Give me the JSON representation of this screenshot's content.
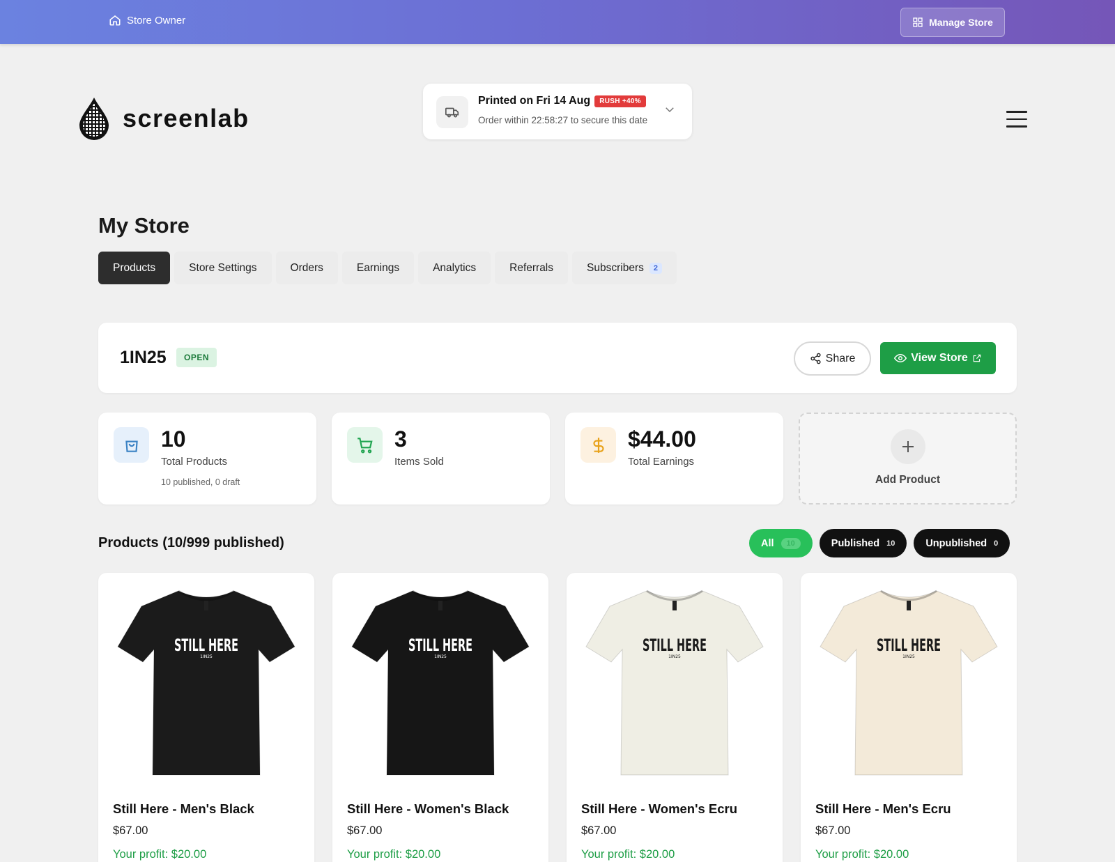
{
  "topbar": {
    "owner_label": "Store Owner",
    "manage_label": "Manage Store"
  },
  "brand": {
    "name": "screenlab"
  },
  "print_notice": {
    "title": "Printed on Fri 14 Aug",
    "badge": "RUSH +40%",
    "subtitle": "Order within 22:58:27 to secure this date"
  },
  "page": {
    "title": "My Store"
  },
  "tabs": [
    {
      "label": "Products"
    },
    {
      "label": "Store Settings"
    },
    {
      "label": "Orders"
    },
    {
      "label": "Earnings"
    },
    {
      "label": "Analytics"
    },
    {
      "label": "Referrals"
    },
    {
      "label": "Subscribers",
      "badge": "2"
    }
  ],
  "store": {
    "name": "1IN25",
    "status": "OPEN",
    "share_label": "Share",
    "view_label": "View Store"
  },
  "stats": [
    {
      "value": "10",
      "label": "Total Products",
      "sub": "10 published, 0 draft"
    },
    {
      "value": "3",
      "label": "Items Sold"
    },
    {
      "value": "$44.00",
      "label": "Total Earnings"
    }
  ],
  "add_product": {
    "label": "Add Product"
  },
  "products_section": {
    "title": "Products (10/999 published)",
    "filters": [
      {
        "label": "All",
        "count": "10"
      },
      {
        "label": "Published",
        "count": "10"
      },
      {
        "label": "Unpublished",
        "count": "0"
      }
    ]
  },
  "products": [
    {
      "name": "Still Here - Men's Black",
      "price": "$67.00",
      "profit": "Your profit: $20.00",
      "shirt_color": "#1b1b1b",
      "print_color": "#ffffff",
      "print_text": "STILL HERE",
      "print_sub": "1IN25"
    },
    {
      "name": "Still Here - Women's Black",
      "price": "$67.00",
      "profit": "Your profit: $20.00",
      "shirt_color": "#161616",
      "print_color": "#ffffff",
      "print_text": "STILL HERE",
      "print_sub": "1IN25"
    },
    {
      "name": "Still Here - Women's Ecru",
      "price": "$67.00",
      "profit": "Your profit: $20.00",
      "shirt_color": "#efeee4",
      "print_color": "#1a1a1a",
      "print_text": "STILL HERE",
      "print_sub": "1IN25"
    },
    {
      "name": "Still Here - Men's Ecru",
      "price": "$67.00",
      "profit": "Your profit: $20.00",
      "shirt_color": "#f3ead9",
      "print_color": "#1a1a1a",
      "print_text": "STILL HERE",
      "print_sub": "1IN25"
    }
  ],
  "colors": {
    "accent_green": "#1e9e46",
    "rush_red": "#e23b3b",
    "gradient_start": "#6b82e0",
    "gradient_end": "#7556b8"
  }
}
